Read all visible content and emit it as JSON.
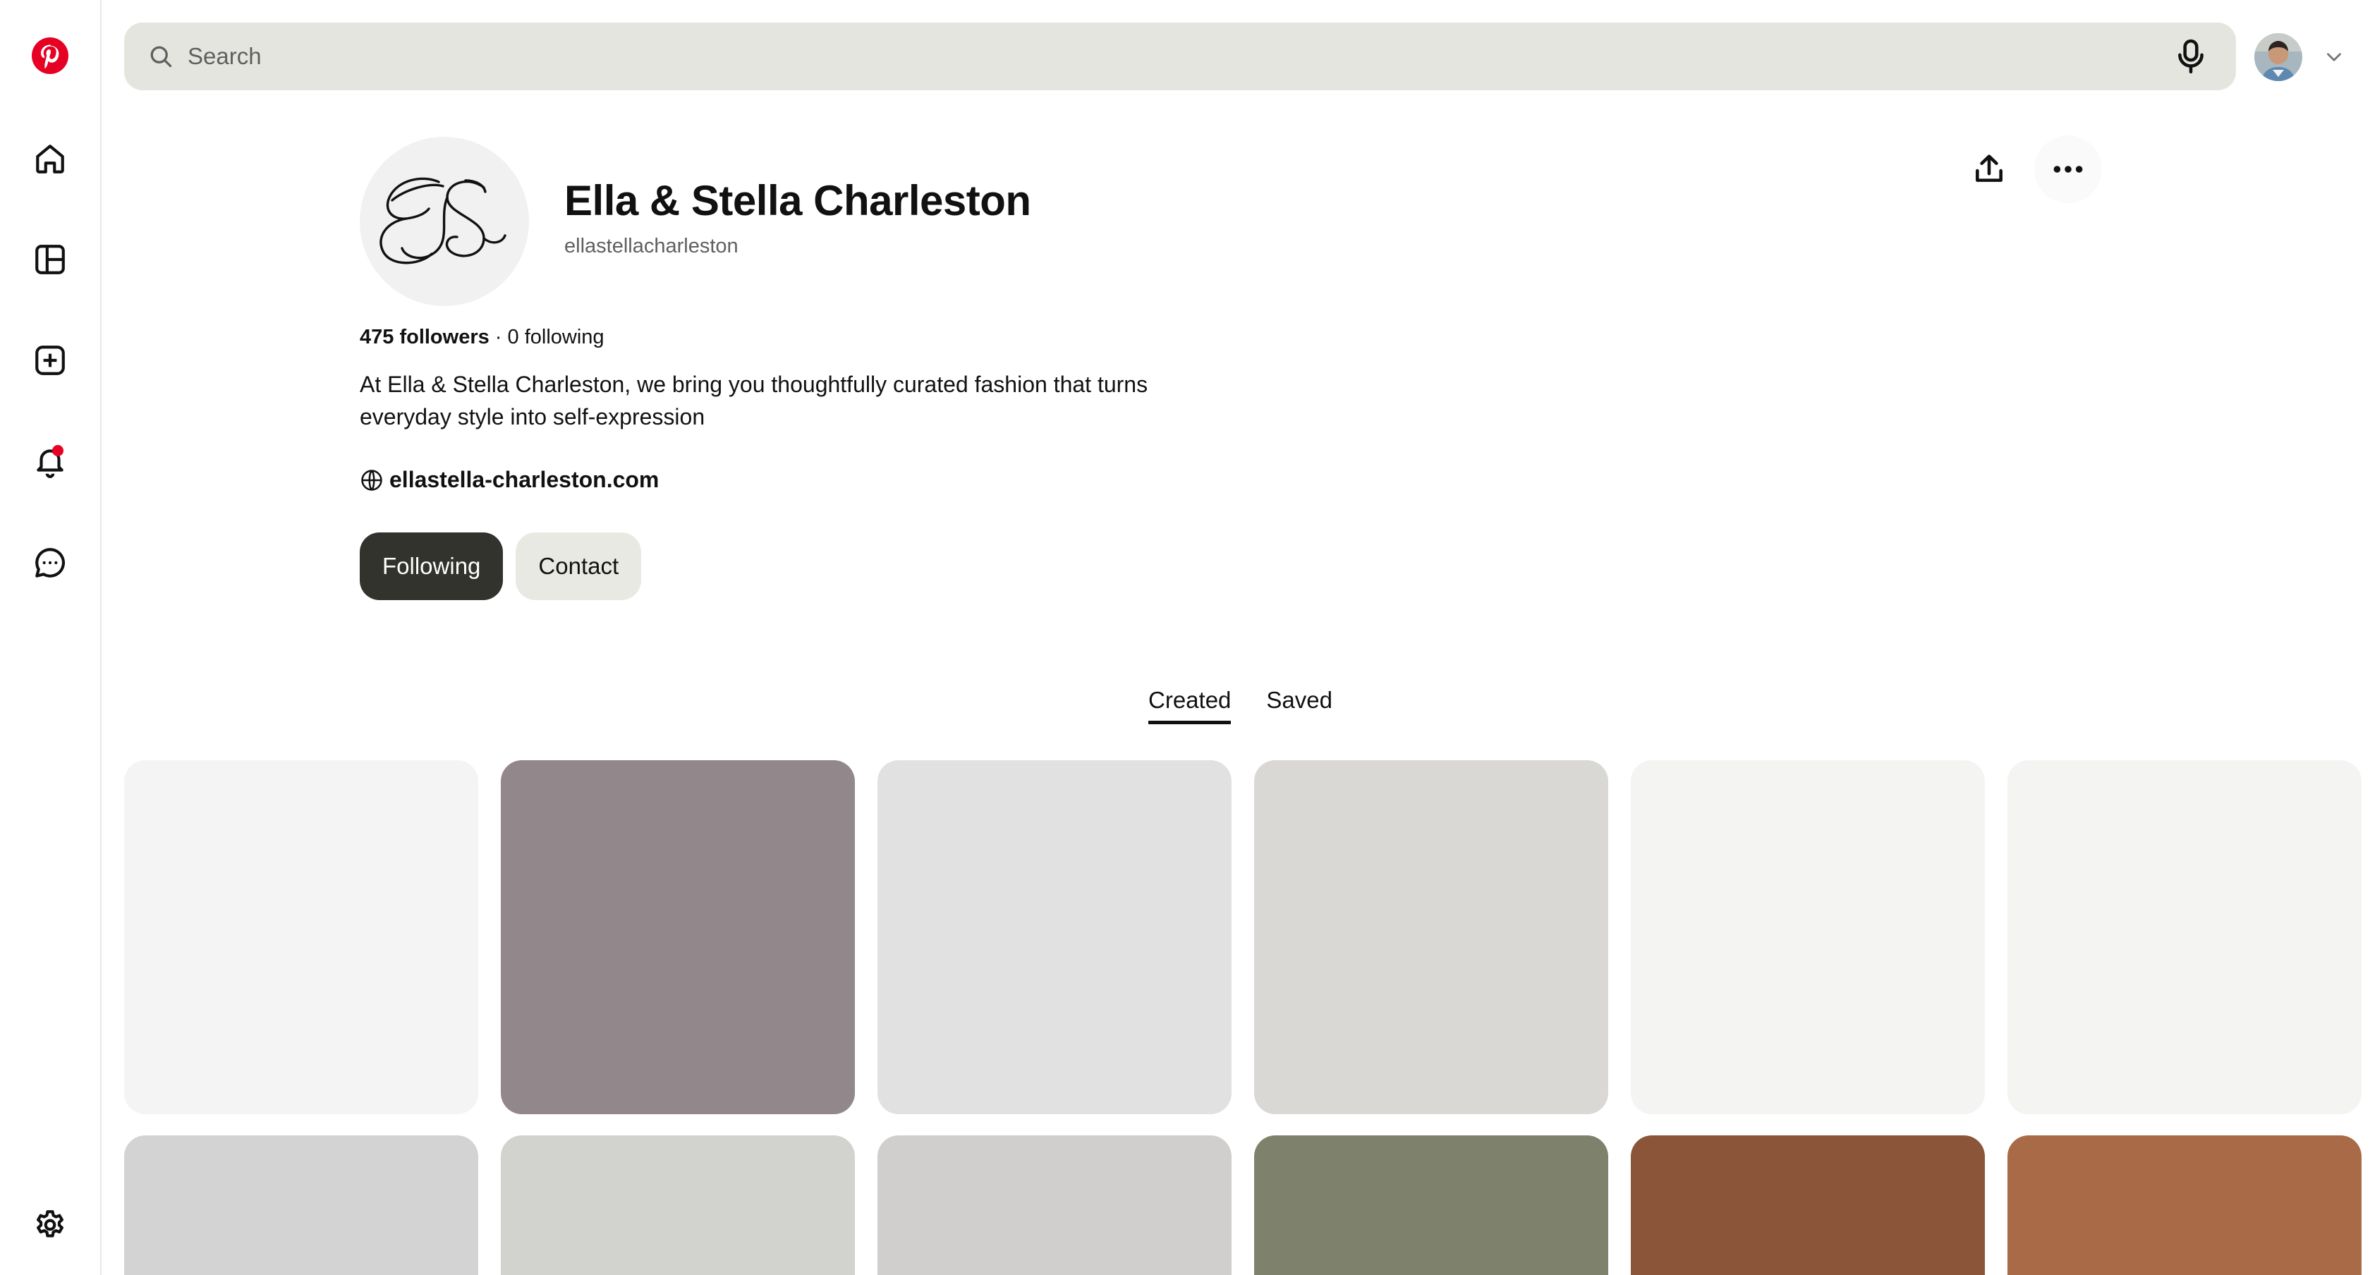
{
  "rail": {
    "items": [
      "pinterest-logo",
      "home-icon",
      "boards-icon",
      "create-icon",
      "notifications-icon",
      "messages-icon",
      "settings-icon"
    ]
  },
  "search": {
    "placeholder": "Search"
  },
  "profile": {
    "name": "Ella & Stella Charleston",
    "handle": "ellastellacharleston",
    "followers": "475 followers",
    "separator": " · ",
    "following": "0 following",
    "bio": "At Ella & Stella Charleston, we bring you thoughtfully curated fashion that turns everyday style into self-expression",
    "website": "ellastella-charleston.com"
  },
  "buttons": {
    "following": "Following",
    "contact": "Contact"
  },
  "tabs": [
    {
      "label": "Created",
      "active": true
    },
    {
      "label": "Saved",
      "active": false
    }
  ],
  "colors": {
    "brand": "#e60023",
    "following_button": "#33332d",
    "contact_button": "#e9e9e4",
    "search_bg": "#e5e5e0"
  },
  "pins": {
    "row1": [
      "#f4f4f4",
      "#92888c",
      "#e1e1e1",
      "#d9d8d5",
      "#f4f4f3",
      "#f4f4f3"
    ],
    "row2": [
      "#d3d3d3",
      "#d2d2ce",
      "#d0cfcd",
      "#7e826c",
      "#8a5538",
      "#a96a47"
    ]
  }
}
